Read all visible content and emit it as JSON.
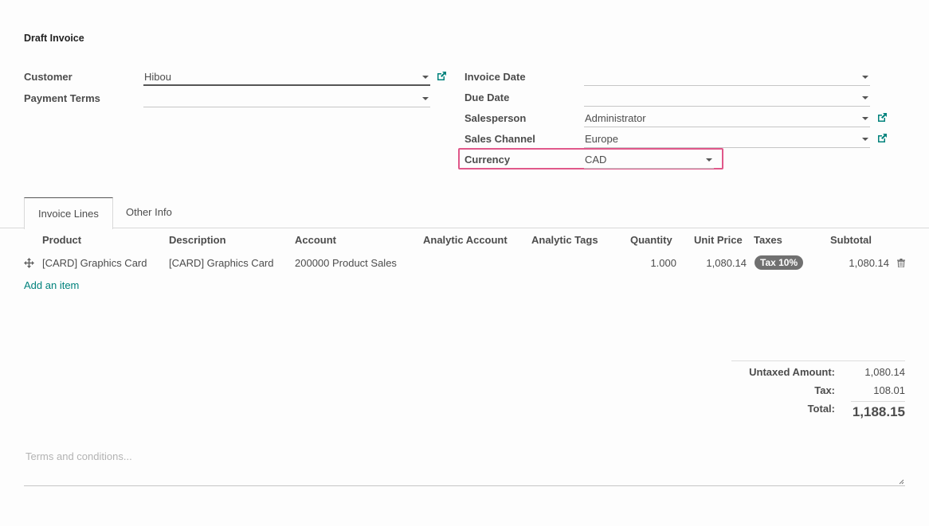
{
  "title": "Draft Invoice",
  "left_fields": [
    {
      "label": "Customer",
      "value": "Hibou",
      "has_external_link": true
    },
    {
      "label": "Payment Terms",
      "value": "",
      "has_external_link": false
    }
  ],
  "right_fields": [
    {
      "label": "Invoice Date",
      "value": "",
      "has_external_link": false
    },
    {
      "label": "Due Date",
      "value": "",
      "has_external_link": false
    },
    {
      "label": "Salesperson",
      "value": "Administrator",
      "has_external_link": true
    },
    {
      "label": "Sales Channel",
      "value": "Europe",
      "has_external_link": true
    },
    {
      "label": "Currency",
      "value": "CAD",
      "has_external_link": false,
      "highlighted": true
    }
  ],
  "tabs": [
    {
      "label": "Invoice Lines",
      "active": true
    },
    {
      "label": "Other Info",
      "active": false
    }
  ],
  "table": {
    "columns": [
      "Product",
      "Description",
      "Account",
      "Analytic Account",
      "Analytic Tags",
      "Quantity",
      "Unit Price",
      "Taxes",
      "Subtotal"
    ],
    "rows": [
      {
        "product": "[CARD] Graphics Card",
        "description": "[CARD] Graphics Card",
        "account": "200000 Product Sales",
        "analytic_account": "",
        "analytic_tags": "",
        "quantity": "1.000",
        "unit_price": "1,080.14",
        "taxes": "Tax 10%",
        "subtotal": "1,080.14"
      }
    ],
    "add_item_label": "Add an item"
  },
  "totals": {
    "untaxed_label": "Untaxed Amount:",
    "untaxed_value": "1,080.14",
    "tax_label": "Tax:",
    "tax_value": "108.01",
    "total_label": "Total:",
    "total_value": "1,188.15"
  },
  "terms": {
    "placeholder": "Terms and conditions..."
  },
  "colors": {
    "accent": "#00827c",
    "highlight": "#e0588a",
    "badge": "#707070"
  }
}
